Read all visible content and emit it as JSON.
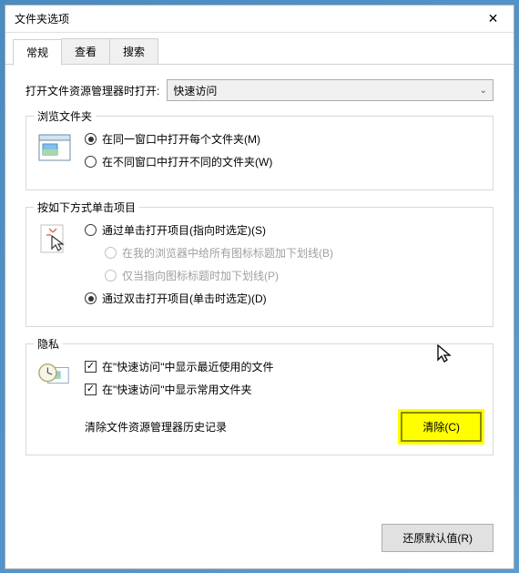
{
  "window": {
    "title": "文件夹选项",
    "close_symbol": "✕"
  },
  "tabs": [
    {
      "label": "常规",
      "active": true
    },
    {
      "label": "查看",
      "active": false
    },
    {
      "label": "搜索",
      "active": false
    }
  ],
  "open_explorer": {
    "label": "打开文件资源管理器时打开:",
    "value": "快速访问"
  },
  "browse": {
    "legend": "浏览文件夹",
    "options": [
      {
        "label": "在同一窗口中打开每个文件夹(M)",
        "checked": true
      },
      {
        "label": "在不同窗口中打开不同的文件夹(W)",
        "checked": false
      }
    ]
  },
  "click": {
    "legend": "按如下方式单击项目",
    "option1": "通过单击打开项目(指向时选定)(S)",
    "sub1": "在我的浏览器中给所有图标标题加下划线(B)",
    "sub2": "仅当指向图标标题时加下划线(P)",
    "option2": "通过双击打开项目(单击时选定)(D)"
  },
  "privacy": {
    "legend": "隐私",
    "checks": [
      {
        "label": "在\"快速访问\"中显示最近使用的文件",
        "checked": true
      },
      {
        "label": "在\"快速访问\"中显示常用文件夹",
        "checked": true
      }
    ],
    "clear_label": "清除文件资源管理器历史记录",
    "clear_button": "清除(C)"
  },
  "footer": {
    "restore_button": "还原默认值(R)"
  }
}
